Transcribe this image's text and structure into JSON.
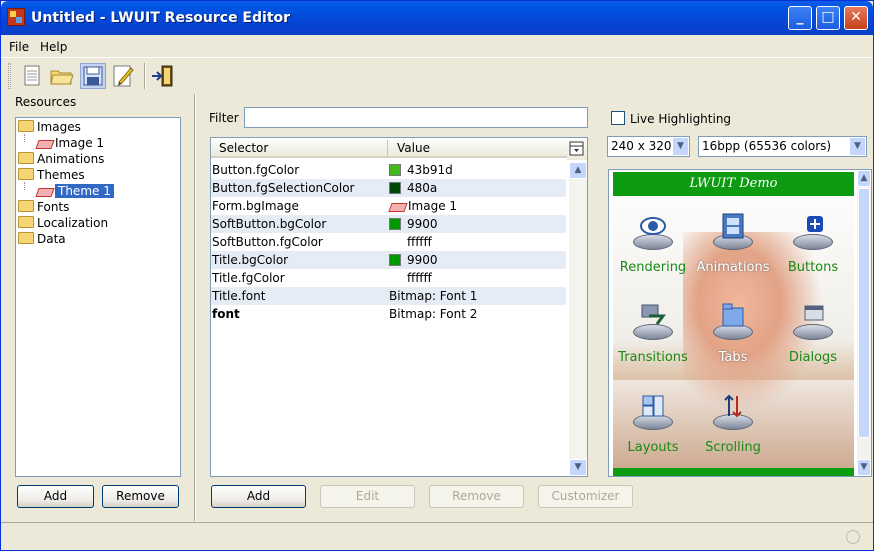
{
  "window": {
    "title": "Untitled - LWUIT Resource Editor"
  },
  "menu": [
    "File",
    "Help"
  ],
  "toolbar": {
    "icons": [
      "new-file-icon",
      "open-folder-icon",
      "save-icon",
      "edit-icon",
      "exit-icon"
    ]
  },
  "resources": {
    "header": "Resources",
    "tree": [
      {
        "label": "Images",
        "type": "folder",
        "level": 0
      },
      {
        "label": "Image 1",
        "type": "item",
        "level": 1
      },
      {
        "label": "Animations",
        "type": "folder",
        "level": 0
      },
      {
        "label": "Themes",
        "type": "folder",
        "level": 0
      },
      {
        "label": "Theme 1",
        "type": "item",
        "level": 1,
        "selected": true
      },
      {
        "label": "Fonts",
        "type": "folder",
        "level": 0
      },
      {
        "label": "Localization",
        "type": "folder",
        "level": 0
      },
      {
        "label": "Data",
        "type": "folder",
        "level": 0
      }
    ],
    "add_label": "Add",
    "remove_label": "Remove"
  },
  "theme": {
    "filter_label": "Filter",
    "filter_value": "",
    "columns": [
      "Selector",
      "Value"
    ],
    "rows": [
      {
        "selector": "Button.fgColor",
        "value": "43b91d",
        "swatch": "#43b91d",
        "bold": false
      },
      {
        "selector": "Button.fgSelectionColor",
        "value": "480a",
        "swatch": "#00480a",
        "bold": false
      },
      {
        "selector": "Form.bgImage",
        "value": "Image 1",
        "icon": "image-icon",
        "bold": false
      },
      {
        "selector": "SoftButton.bgColor",
        "value": "9900",
        "swatch": "#009900",
        "bold": false
      },
      {
        "selector": "SoftButton.fgColor",
        "value": "ffffff",
        "swatch": "#ffffff",
        "bold": false
      },
      {
        "selector": "Title.bgColor",
        "value": "9900",
        "swatch": "#009900",
        "bold": false
      },
      {
        "selector": "Title.fgColor",
        "value": "ffffff",
        "swatch": "#ffffff",
        "bold": false
      },
      {
        "selector": "Title.font",
        "value": "Bitmap: Font 1",
        "bold": false
      },
      {
        "selector": "font",
        "value": "Bitmap: Font 2",
        "bold": true
      }
    ],
    "buttons": {
      "add": "Add",
      "edit": "Edit",
      "remove": "Remove",
      "customizer": "Customizer"
    }
  },
  "preview": {
    "live_highlighting_label": "Live Highlighting",
    "live_highlighting_checked": false,
    "resolution": "240 x 320",
    "color_depth": "16bpp (65536 colors)",
    "phone_title": "LWUIT Demo",
    "menu_items": [
      "Rendering",
      "Animations",
      "Buttons",
      "Transitions",
      "Tabs",
      "Dialogs",
      "Layouts",
      "Scrolling"
    ]
  }
}
